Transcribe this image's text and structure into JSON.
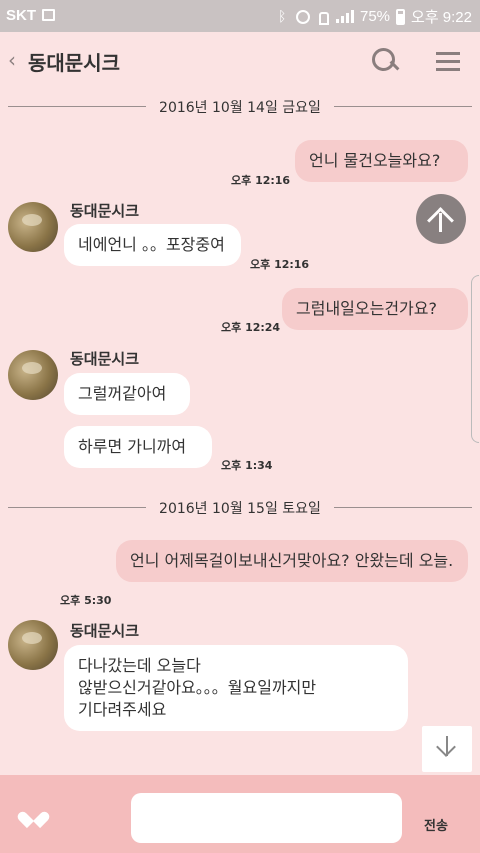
{
  "status_bar": {
    "carrier": "SKT",
    "battery": "75%",
    "clock": "오후 9:22"
  },
  "header": {
    "title": "동대문시크",
    "back_icon": "chevron-left-icon",
    "search_icon": "search-icon",
    "menu_icon": "menu-icon"
  },
  "dates": [
    "2016년 10월 14일 금요일",
    "2016년 10월 15일 토요일"
  ],
  "messages": [
    {
      "from": "me",
      "text": "언니 물건오늘와요?",
      "time": "오후 12:16"
    },
    {
      "from": "them",
      "sender": "동대문시크",
      "text": "네에언니 。。포장중여",
      "time": "오후 12:16"
    },
    {
      "from": "me",
      "text": "그럼내일오는건가요?",
      "time": "오후 12:24"
    },
    {
      "from": "them",
      "sender": "동대문시크",
      "text": "그럴꺼같아여"
    },
    {
      "from": "them",
      "text": "하루면 가니까여",
      "time": "오후 1:34"
    },
    {
      "from": "me",
      "text": "언니 어제목걸이보내신거맞아요? 안왔는데 오늘.",
      "time": "오후 5:30"
    },
    {
      "from": "them",
      "sender": "동대문시크",
      "text": "다나갔는데 오늘다\n않받으신거같아요。。。월요일까지만\n기다려주세요"
    }
  ],
  "input": {
    "placeholder": "",
    "send_label": "전송",
    "heart_icon": "heart-icon"
  },
  "colors": {
    "background": "#fbe3e3",
    "my_bubble": "#f6cccc",
    "their_bubble": "#ffffff",
    "input_bar": "#f4bcbc"
  }
}
